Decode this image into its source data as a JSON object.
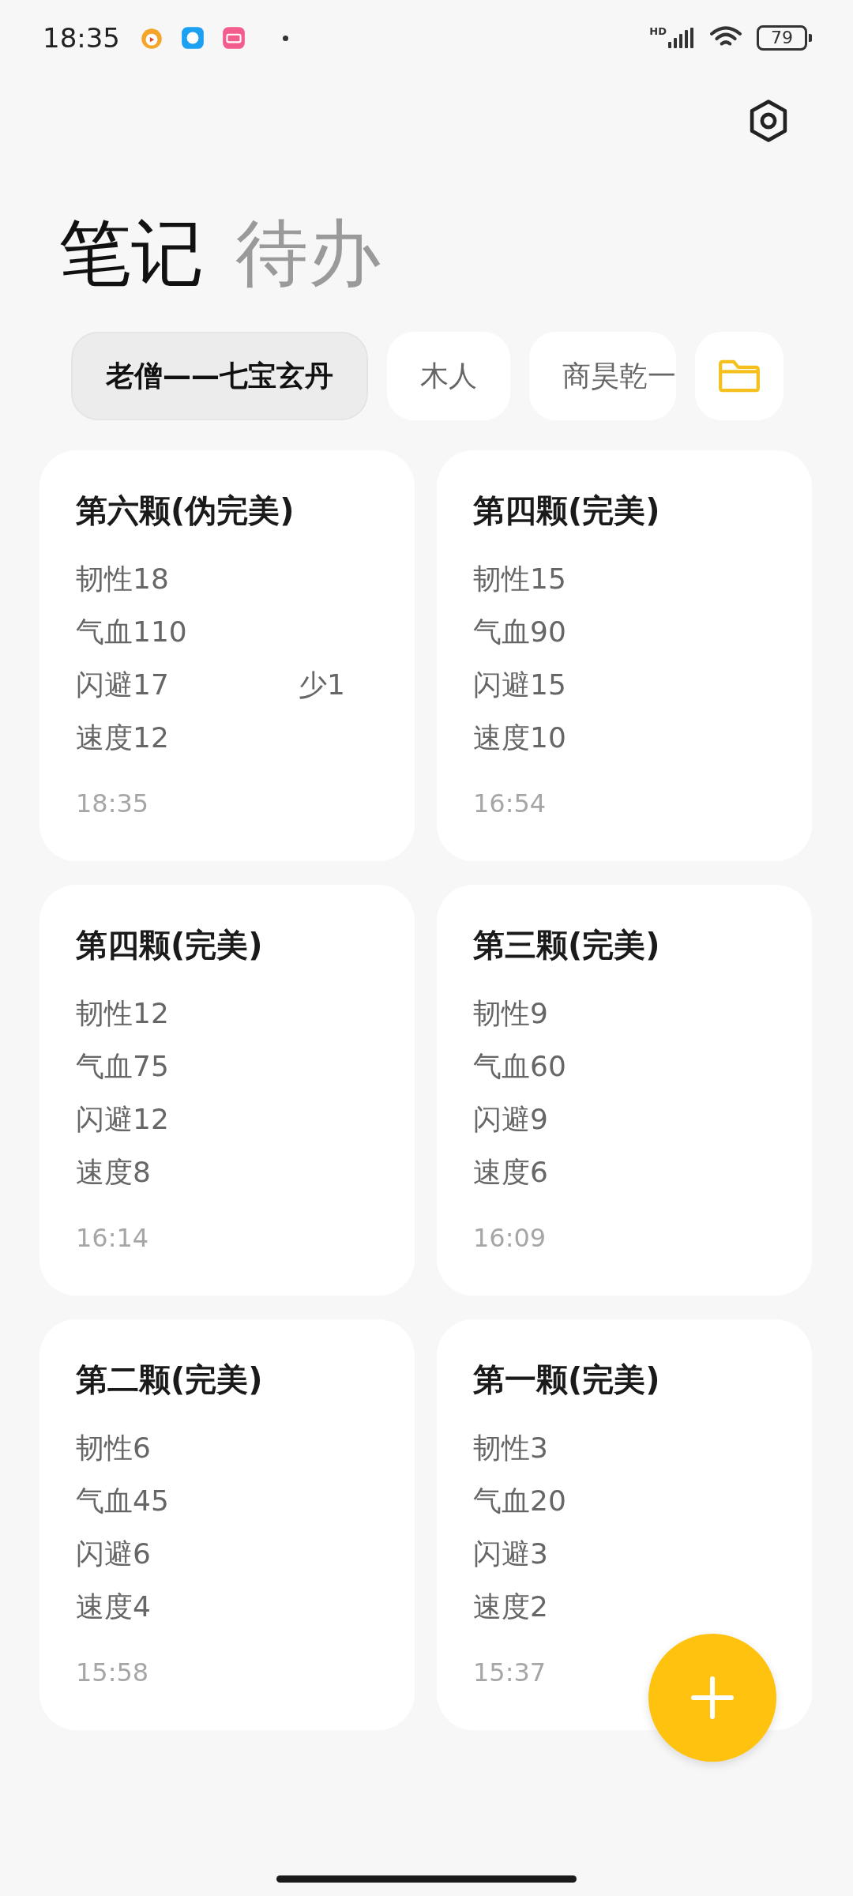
{
  "status_bar": {
    "time": "18:35",
    "network_label": "HD",
    "battery": "79"
  },
  "tabs": [
    {
      "label": "笔记",
      "selected": true
    },
    {
      "label": "待办",
      "selected": false
    }
  ],
  "folders": [
    {
      "label": "老僧——七宝玄丹",
      "selected": true
    },
    {
      "label": "木人",
      "selected": false
    },
    {
      "label": "商昊乾一",
      "selected": false
    }
  ],
  "notes": [
    {
      "title": "第六颗(伪完美)",
      "lines": [
        {
          "text": "韧性18"
        },
        {
          "text": "气血110"
        },
        {
          "text": "闪避17",
          "note": "少1"
        },
        {
          "text": "速度12"
        }
      ],
      "time": "18:35"
    },
    {
      "title": "第四颗(完美)",
      "lines": [
        {
          "text": "韧性15"
        },
        {
          "text": "气血90"
        },
        {
          "text": "闪避15"
        },
        {
          "text": "速度10"
        }
      ],
      "time": "16:54"
    },
    {
      "title": "第四颗(完美)",
      "lines": [
        {
          "text": "韧性12"
        },
        {
          "text": "气血75"
        },
        {
          "text": "闪避12"
        },
        {
          "text": "速度8"
        }
      ],
      "time": "16:14"
    },
    {
      "title": "第三颗(完美)",
      "lines": [
        {
          "text": "韧性9"
        },
        {
          "text": "气血60"
        },
        {
          "text": "闪避9"
        },
        {
          "text": "速度6"
        }
      ],
      "time": "16:09"
    },
    {
      "title": "第二颗(完美)",
      "lines": [
        {
          "text": "韧性6"
        },
        {
          "text": "气血45"
        },
        {
          "text": "闪避6"
        },
        {
          "text": "速度4"
        }
      ],
      "time": "15:58"
    },
    {
      "title": "第一颗(完美)",
      "lines": [
        {
          "text": "韧性3"
        },
        {
          "text": "气血20"
        },
        {
          "text": "闪避3"
        },
        {
          "text": "速度2"
        }
      ],
      "time": "15:37"
    }
  ]
}
